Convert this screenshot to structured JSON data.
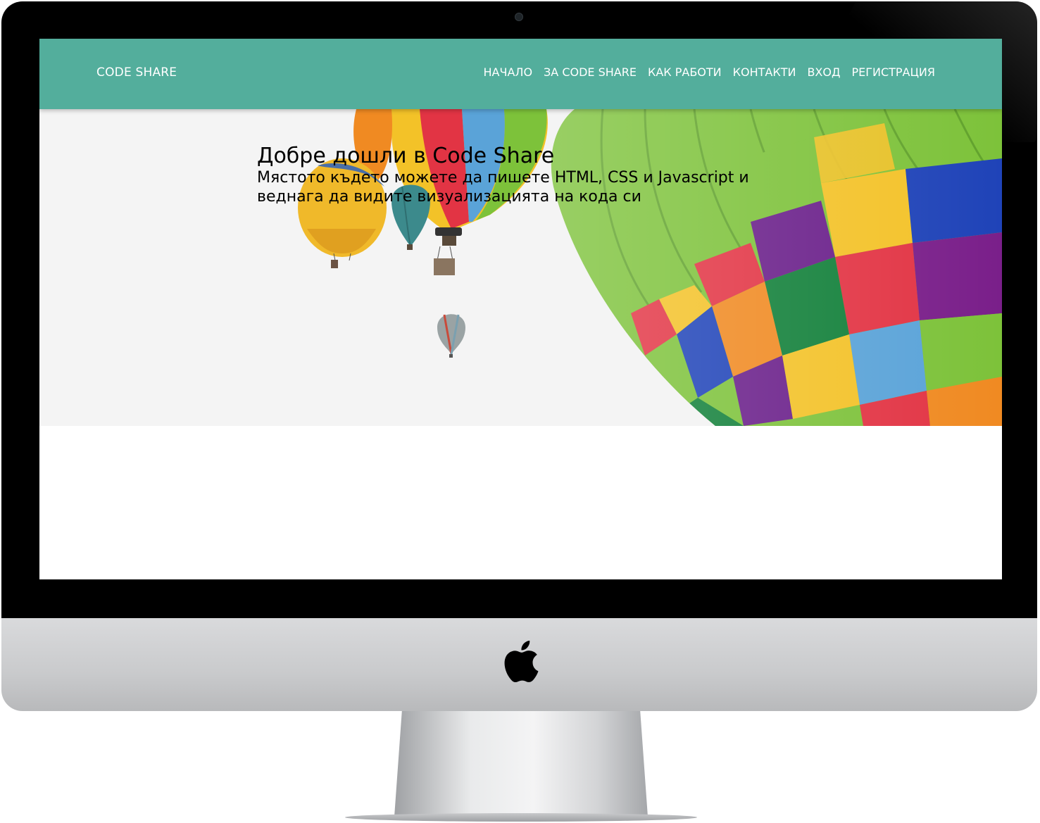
{
  "navbar": {
    "brand": "CODE SHARE",
    "links": [
      "НАЧАЛО",
      "ЗА CODE SHARE",
      "КАК РАБОТИ",
      "КОНТАКТИ",
      "ВХОД",
      "РЕГИСТРАЦИЯ"
    ]
  },
  "hero": {
    "title": "Добре дошли в Code Share",
    "subtitle": "Мястото където можете да пишете HTML, CSS и Javascript и веднага да видите визуализацията на кода си"
  },
  "colors": {
    "navbar": "#53ae9c",
    "hero_background": "#f4f4f4",
    "bezel": "#000000",
    "chin": "#cbcccd"
  },
  "icons": {
    "device_logo": "apple-logo-icon"
  }
}
